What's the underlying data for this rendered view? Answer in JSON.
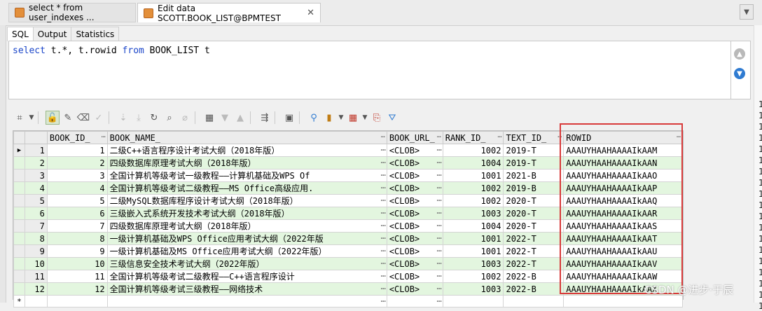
{
  "tabs": [
    {
      "label": "select * from user_indexes ...",
      "icon": "sql-window-icon",
      "active": false
    },
    {
      "label": "Edit data SCOTT.BOOK_LIST@BPMTEST",
      "icon": "sql-window-icon",
      "active": true
    }
  ],
  "subtabs": [
    "SQL",
    "Output",
    "Statistics"
  ],
  "editor": {
    "kw1": "select",
    "part1": " t.*, t.rowid ",
    "kw2": "from",
    "part2": " BOOK_LIST t"
  },
  "grid": {
    "columns": [
      "BOOK_ID_",
      "BOOK_NAME_",
      "BOOK_URL_",
      "RANK_ID_",
      "TEXT_ID_",
      "ROWID"
    ],
    "rows": [
      {
        "n": "1",
        "id": "1",
        "name": "二级C++语言程序设计考试大纲（2018年版）",
        "url": "<CLOB>",
        "rank": "1002",
        "text": "2019-T",
        "rowid": "AAAUYHAAHAAAAIkAAM"
      },
      {
        "n": "2",
        "id": "2",
        "name": "四级数据库原理考试大纲（2018年版）",
        "url": "<CLOB>",
        "rank": "1004",
        "text": "2019-T",
        "rowid": "AAAUYHAAHAAAAIkAAN"
      },
      {
        "n": "3",
        "id": "3",
        "name": "全国计算机等级考试一级教程——计算机基础及WPS Of",
        "url": "<CLOB>",
        "rank": "1001",
        "text": "2021-B",
        "rowid": "AAAUYHAAHAAAAIkAAO"
      },
      {
        "n": "4",
        "id": "4",
        "name": "全国计算机等级考试二级教程——MS Office高级应用.",
        "url": "<CLOB>",
        "rank": "1002",
        "text": "2019-B",
        "rowid": "AAAUYHAAHAAAAIkAAP"
      },
      {
        "n": "5",
        "id": "5",
        "name": "二级MySQL数据库程序设计考试大纲（2018年版）",
        "url": "<CLOB>",
        "rank": "1002",
        "text": "2020-T",
        "rowid": "AAAUYHAAHAAAAIkAAQ"
      },
      {
        "n": "6",
        "id": "6",
        "name": "三级嵌入式系统开发技术考试大纲（2018年版）",
        "url": "<CLOB>",
        "rank": "1003",
        "text": "2020-T",
        "rowid": "AAAUYHAAHAAAAIkAAR"
      },
      {
        "n": "7",
        "id": "7",
        "name": "四级数据库原理考试大纲（2018年版）",
        "url": "<CLOB>",
        "rank": "1004",
        "text": "2020-T",
        "rowid": "AAAUYHAAHAAAAIkAAS"
      },
      {
        "n": "8",
        "id": "8",
        "name": "一级计算机基础及WPS Office应用考试大纲（2022年版",
        "url": "<CLOB>",
        "rank": "1001",
        "text": "2022-T",
        "rowid": "AAAUYHAAHAAAAIkAAT"
      },
      {
        "n": "9",
        "id": "9",
        "name": "一级计算机基础及MS Office应用考试大纲（2022年版）",
        "url": "<CLOB>",
        "rank": "1001",
        "text": "2022-T",
        "rowid": "AAAUYHAAHAAAAIkAAU"
      },
      {
        "n": "10",
        "id": "10",
        "name": "三级信息安全技术考试大纲（2022年版）",
        "url": "<CLOB>",
        "rank": "1003",
        "text": "2022-T",
        "rowid": "AAAUYHAAHAAAAIkAAV"
      },
      {
        "n": "11",
        "id": "11",
        "name": "全国计算机等级考试二级教程——C++语言程序设计",
        "url": "<CLOB>",
        "rank": "1002",
        "text": "2022-B",
        "rowid": "AAAUYHAAHAAAAIkAAW"
      },
      {
        "n": "12",
        "id": "12",
        "name": "全国计算机等级考试三级教程——网络技术",
        "url": "<CLOB>",
        "rank": "1003",
        "text": "2022-B",
        "rowid": "AAAUYHAAHAAAAIkAAX"
      }
    ],
    "new_row_marker": "*",
    "current_row_marker": "▶"
  },
  "right_gutter_numbers": [
    "1",
    "1",
    "1",
    "1",
    "1",
    "1",
    "1",
    "1",
    "1",
    "1",
    "1",
    "1",
    "1",
    "1",
    "1",
    "1",
    "1",
    "1",
    "1"
  ],
  "watermark": "CSDN @进步·于辰",
  "colors": {
    "alt_row": "#e3f6df",
    "highlight": "#d83a3a",
    "keyword": "#1b46c9"
  }
}
